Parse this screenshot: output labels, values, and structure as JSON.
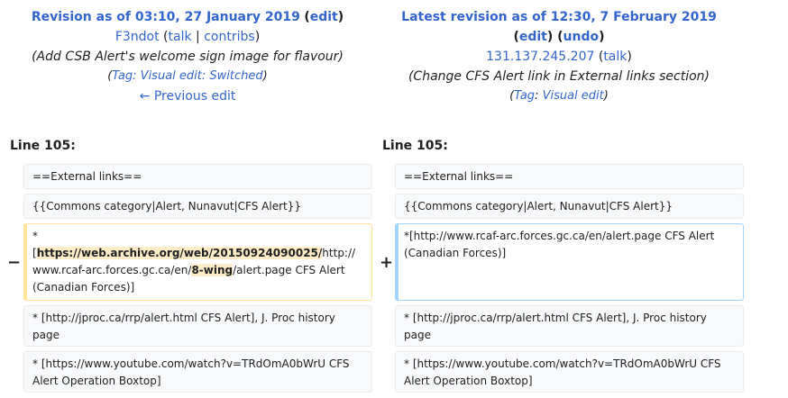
{
  "left_header": {
    "title_prefix": "Revision as of 03:10, 27 January 2019",
    "edit_label": "edit",
    "user": "F3ndot",
    "talk": "talk",
    "contribs": "contribs",
    "summary": "(Add CSB Alert's welcome sign image for flavour)",
    "tag_text": "Tag: Visual edit: Switched",
    "prev_edit": "← Previous edit"
  },
  "right_header": {
    "title": "Latest revision as of 12:30, 7 February 2019",
    "edit_label": "edit",
    "undo_label": "undo",
    "ip": "131.137.245.207",
    "talk": "talk",
    "summary": "(Change CFS Alert link in External links section)",
    "tag_prefix": "Tag",
    "tag_value": "Visual edit"
  },
  "line_left": "Line 105:",
  "line_right": "Line 105:",
  "diff": {
    "ext_links": "==External links==",
    "commons": "{{Commons category|Alert, Nunavut|CFS Alert}}",
    "del": {
      "star": "*",
      "p1": "[",
      "h1": "https://web.archive.org/web/20150924090025/",
      "p2": "http://www.rcaf-arc.forces.gc.ca/en/",
      "h2": "8-wing",
      "p3": "/alert.page CFS Alert (Canadian Forces)]"
    },
    "add": "*[http://www.rcaf-arc.forces.gc.ca/en/alert.page CFS Alert (Canadian Forces)]",
    "jproc": "* [http://jproc.ca/rrp/alert.html CFS Alert], J. Proc history page",
    "youtube": "* [https://www.youtube.com/watch?v=TRdOmA0bWrU CFS Alert Operation Boxtop]",
    "minus": "−",
    "plus": "+"
  }
}
